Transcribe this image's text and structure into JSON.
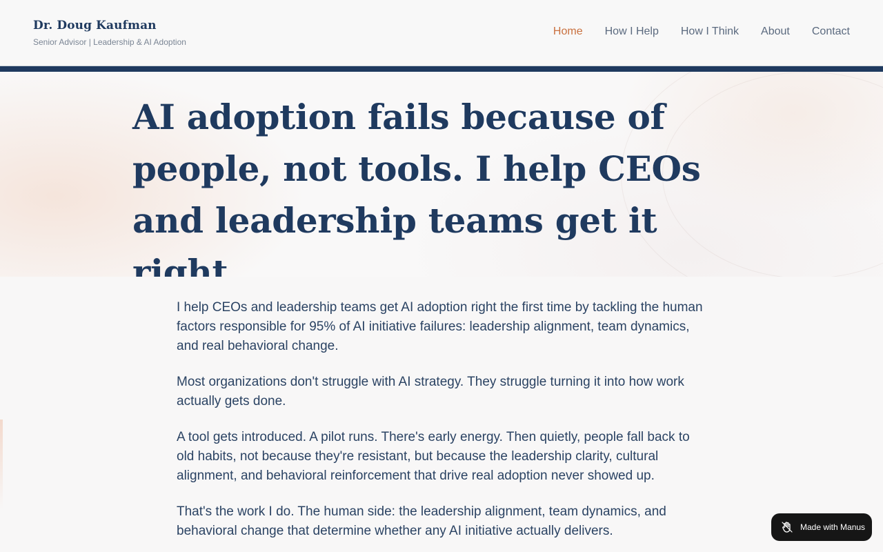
{
  "brand": {
    "name": "Dr. Doug Kaufman",
    "tagline": "Senior Advisor | Leadership & AI Adoption"
  },
  "nav": {
    "items": [
      {
        "label": "Home",
        "active": true
      },
      {
        "label": "How I Help",
        "active": false
      },
      {
        "label": "How I Think",
        "active": false
      },
      {
        "label": "About",
        "active": false
      },
      {
        "label": "Contact",
        "active": false
      }
    ]
  },
  "hero": {
    "title": "AI adoption fails because of people, not tools. I help CEOs and leadership teams get it right."
  },
  "content": {
    "paragraphs": [
      "I help CEOs and leadership teams get AI adoption right the first time by tackling the human factors responsible for 95% of AI initiative failures: leadership alignment, team dynamics, and real behavioral change.",
      "Most organizations don't struggle with AI strategy. They struggle turning it into how work actually gets done.",
      "A tool gets introduced. A pilot runs. There's early energy. Then quietly, people fall back to old habits, not because they're resistant, but because the leadership clarity, cultural alignment, and behavioral reinforcement that drive real adoption never showed up.",
      "That's the work I do. The human side: the leadership alignment, team dynamics, and behavioral change that determine whether any AI initiative actually delivers."
    ]
  },
  "badge": {
    "label": "Made with Manus",
    "icon": "manus-hand-icon"
  },
  "colors": {
    "navy": "#1f3a5f",
    "accent": "#c9703e",
    "badge_bg": "#161616"
  }
}
